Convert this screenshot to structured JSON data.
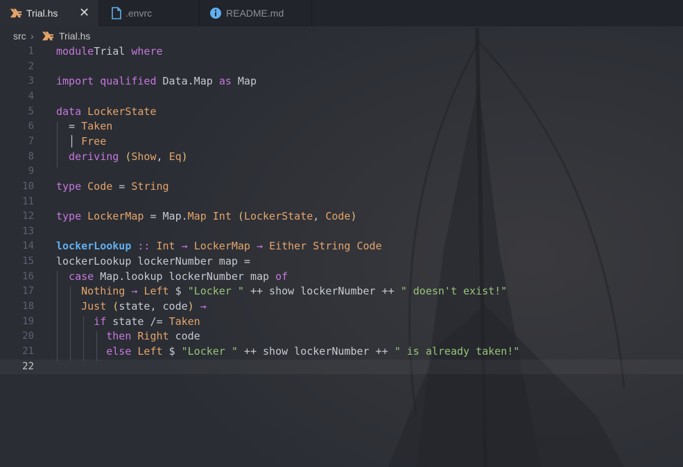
{
  "tabs": [
    {
      "label": "Trial.hs",
      "icon": "haskell-icon",
      "active": true,
      "close": "✕"
    },
    {
      "label": ".envrc",
      "icon": "file-icon",
      "active": false
    },
    {
      "label": "README.md",
      "icon": "info-icon",
      "active": false
    }
  ],
  "breadcrumb": {
    "folder": "src",
    "separator": "›",
    "file": "Trial.hs"
  },
  "colors": {
    "haskell": "#e5a56b",
    "keyword": "#c678dd",
    "type": "#e5a56b",
    "string": "#98c379",
    "function": "#61afef",
    "info": "#61afef"
  },
  "current_line": 22,
  "lines": [
    {
      "n": "1",
      "tokens": [
        [
          "kw",
          "module"
        ],
        [
          "",
          "Trial "
        ],
        [
          "kw",
          "where"
        ]
      ]
    },
    {
      "n": "2",
      "tokens": []
    },
    {
      "n": "3",
      "tokens": [
        [
          "kw",
          "import qualified "
        ],
        [
          "",
          "Data.Map "
        ],
        [
          "kw",
          "as "
        ],
        [
          "",
          "Map"
        ]
      ]
    },
    {
      "n": "4",
      "tokens": []
    },
    {
      "n": "5",
      "tokens": [
        [
          "kw",
          "data "
        ],
        [
          "ty",
          "LockerState"
        ]
      ]
    },
    {
      "n": "6",
      "tokens": [
        [
          "",
          "  = "
        ],
        [
          "ty",
          "Taken"
        ]
      ]
    },
    {
      "n": "7",
      "tokens": [
        [
          "",
          "  │ "
        ],
        [
          "ty",
          "Free"
        ]
      ]
    },
    {
      "n": "8",
      "tokens": [
        [
          "kw",
          "  deriving "
        ],
        [
          "pa",
          "("
        ],
        [
          "ty",
          "Show"
        ],
        [
          "",
          ", "
        ],
        [
          "ty",
          "Eq"
        ],
        [
          "pa",
          ")"
        ]
      ]
    },
    {
      "n": "9",
      "tokens": []
    },
    {
      "n": "10",
      "tokens": [
        [
          "kw",
          "type "
        ],
        [
          "ty",
          "Code"
        ],
        [
          "",
          " = "
        ],
        [
          "ty",
          "String"
        ]
      ]
    },
    {
      "n": "11",
      "tokens": []
    },
    {
      "n": "12",
      "tokens": [
        [
          "kw",
          "type "
        ],
        [
          "ty",
          "LockerMap"
        ],
        [
          "",
          " = Map."
        ],
        [
          "ty",
          "Map Int "
        ],
        [
          "pa",
          "("
        ],
        [
          "ty",
          "LockerState"
        ],
        [
          "",
          ", "
        ],
        [
          "ty",
          "Code"
        ],
        [
          "pa",
          ")"
        ]
      ]
    },
    {
      "n": "13",
      "tokens": []
    },
    {
      "n": "14",
      "tokens": [
        [
          "fn",
          "lockerLookup"
        ],
        [
          "op",
          " :: "
        ],
        [
          "ty",
          "Int"
        ],
        [
          "op",
          " → "
        ],
        [
          "ty",
          "LockerMap"
        ],
        [
          "op",
          " → "
        ],
        [
          "ty",
          "Either String Code"
        ]
      ]
    },
    {
      "n": "15",
      "tokens": [
        [
          "",
          "lockerLookup lockerNumber map ="
        ]
      ]
    },
    {
      "n": "16",
      "tokens": [
        [
          "kw",
          "  case "
        ],
        [
          "",
          "Map.lookup lockerNumber map "
        ],
        [
          "kw",
          "of"
        ]
      ]
    },
    {
      "n": "17",
      "tokens": [
        [
          "ty",
          "    Nothing"
        ],
        [
          "op",
          " → "
        ],
        [
          "ty",
          "Left"
        ],
        [
          "",
          " $ "
        ],
        [
          "st",
          "\"Locker \""
        ],
        [
          "",
          " ++ show lockerNumber ++ "
        ],
        [
          "st",
          "\" doesn't exist!\""
        ]
      ]
    },
    {
      "n": "18",
      "tokens": [
        [
          "ty",
          "    Just "
        ],
        [
          "pa",
          "("
        ],
        [
          "",
          "state, code"
        ],
        [
          "pa",
          ")"
        ],
        [
          "op",
          " →"
        ]
      ]
    },
    {
      "n": "19",
      "tokens": [
        [
          "kw",
          "      if "
        ],
        [
          "",
          "state /= "
        ],
        [
          "ty",
          "Taken"
        ]
      ]
    },
    {
      "n": "20",
      "tokens": [
        [
          "kw",
          "        then "
        ],
        [
          "ty",
          "Right "
        ],
        [
          "",
          "code"
        ]
      ]
    },
    {
      "n": "21",
      "tokens": [
        [
          "kw",
          "        else "
        ],
        [
          "ty",
          "Left"
        ],
        [
          "",
          " $ "
        ],
        [
          "st",
          "\"Locker \""
        ],
        [
          "",
          " ++ show lockerNumber ++ "
        ],
        [
          "st",
          "\" is already taken!\""
        ]
      ]
    },
    {
      "n": "22",
      "tokens": []
    }
  ]
}
